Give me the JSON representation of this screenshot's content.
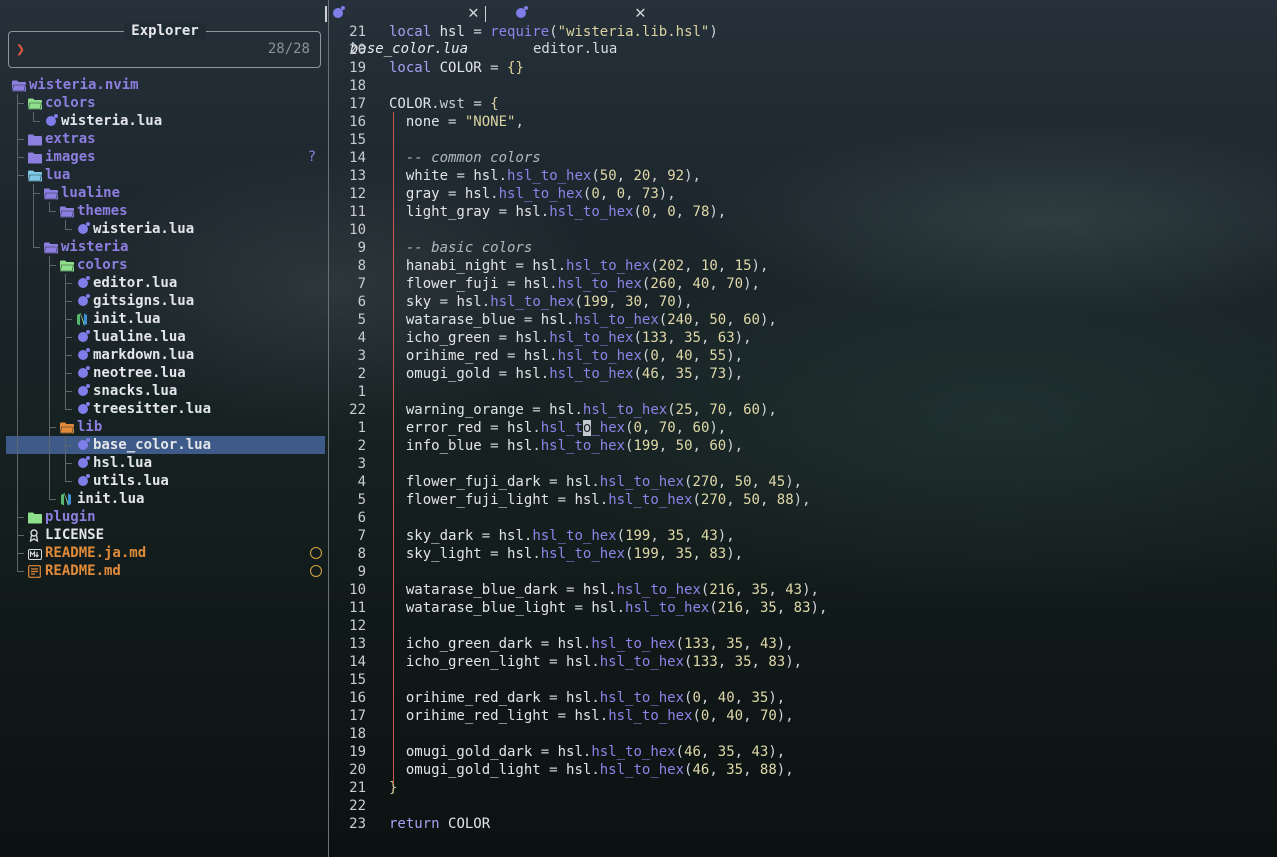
{
  "explorer": {
    "title": "Explorer",
    "prompt_icon": "chevron-right-icon",
    "count": "28/28",
    "tree": [
      {
        "label": "wisteria.nvim",
        "kind": "root",
        "depth": 0,
        "icon": "folder-open-icon"
      },
      {
        "label": "colors",
        "kind": "dir",
        "depth": 1,
        "icon": "folder-open-icon",
        "icon_color": "#8fe08a"
      },
      {
        "label": "wisteria.lua",
        "kind": "file",
        "depth": 2,
        "icon": "lua-icon"
      },
      {
        "label": "extras",
        "kind": "dir",
        "depth": 1,
        "icon": "folder-icon"
      },
      {
        "label": "images",
        "kind": "dir",
        "depth": 1,
        "icon": "folder-icon",
        "badge": "?"
      },
      {
        "label": "lua",
        "kind": "dir",
        "depth": 1,
        "icon": "folder-open-icon",
        "icon_color": "#7fc8e6"
      },
      {
        "label": "lualine",
        "kind": "dir",
        "depth": 2,
        "icon": "folder-open-icon"
      },
      {
        "label": "themes",
        "kind": "dir",
        "depth": 3,
        "icon": "folder-open-icon"
      },
      {
        "label": "wisteria.lua",
        "kind": "file",
        "depth": 4,
        "icon": "lua-icon"
      },
      {
        "label": "wisteria",
        "kind": "dir",
        "depth": 2,
        "icon": "folder-open-icon"
      },
      {
        "label": "colors",
        "kind": "dir",
        "depth": 3,
        "icon": "folder-open-icon",
        "icon_color": "#8fe08a"
      },
      {
        "label": "editor.lua",
        "kind": "file",
        "depth": 4,
        "icon": "lua-icon"
      },
      {
        "label": "gitsigns.lua",
        "kind": "file",
        "depth": 4,
        "icon": "lua-icon"
      },
      {
        "label": "init.lua",
        "kind": "file",
        "depth": 4,
        "icon": "neovim-icon"
      },
      {
        "label": "lualine.lua",
        "kind": "file",
        "depth": 4,
        "icon": "lua-icon"
      },
      {
        "label": "markdown.lua",
        "kind": "file",
        "depth": 4,
        "icon": "lua-icon"
      },
      {
        "label": "neotree.lua",
        "kind": "file",
        "depth": 4,
        "icon": "lua-icon"
      },
      {
        "label": "snacks.lua",
        "kind": "file",
        "depth": 4,
        "icon": "lua-icon"
      },
      {
        "label": "treesitter.lua",
        "kind": "file",
        "depth": 4,
        "icon": "lua-icon"
      },
      {
        "label": "lib",
        "kind": "dir",
        "depth": 3,
        "icon": "folder-open-icon",
        "icon_color": "#e08a3a"
      },
      {
        "label": "base_color.lua",
        "kind": "file",
        "depth": 4,
        "icon": "lua-icon",
        "selected": true
      },
      {
        "label": "hsl.lua",
        "kind": "file",
        "depth": 4,
        "icon": "lua-icon"
      },
      {
        "label": "utils.lua",
        "kind": "file",
        "depth": 4,
        "icon": "lua-icon"
      },
      {
        "label": "init.lua",
        "kind": "file",
        "depth": 3,
        "icon": "neovim-icon"
      },
      {
        "label": "plugin",
        "kind": "dir",
        "depth": 1,
        "icon": "folder-icon",
        "icon_color": "#8fe08a"
      },
      {
        "label": "LICENSE",
        "kind": "file",
        "depth": 1,
        "icon": "license-icon"
      },
      {
        "label": "README.ja.md",
        "kind": "md",
        "depth": 1,
        "icon": "markdown-icon",
        "badge": "circle"
      },
      {
        "label": "README.md",
        "kind": "md",
        "depth": 1,
        "icon": "readme-icon",
        "badge": "circle"
      }
    ]
  },
  "tabs": [
    {
      "label": "base_color.lua",
      "active": true,
      "icon": "lua-icon",
      "close_icon": "close-icon"
    },
    {
      "label": "editor.lua",
      "active": false,
      "icon": "lua-icon",
      "close_icon": "close-icon"
    }
  ],
  "editor": {
    "cursor_line_index": 22,
    "cursor_col": 12,
    "lines": [
      {
        "n": "21",
        "code": "local hsl = require(\"wisteria.lib.hsl\")"
      },
      {
        "n": "20",
        "code": ""
      },
      {
        "n": "19",
        "code": "local COLOR = {}"
      },
      {
        "n": "18",
        "code": ""
      },
      {
        "n": "17",
        "code": "COLOR.wst = {"
      },
      {
        "n": "16",
        "code": "  none = \"NONE\","
      },
      {
        "n": "15",
        "code": ""
      },
      {
        "n": "14",
        "code": "  -- common colors"
      },
      {
        "n": "13",
        "code": "  white = hsl.hsl_to_hex(50, 20, 92),"
      },
      {
        "n": "12",
        "code": "  gray = hsl.hsl_to_hex(0, 0, 73),"
      },
      {
        "n": "11",
        "code": "  light_gray = hsl.hsl_to_hex(0, 0, 78),"
      },
      {
        "n": "10",
        "code": ""
      },
      {
        "n": "9",
        "code": "  -- basic colors"
      },
      {
        "n": "8",
        "code": "  hanabi_night = hsl.hsl_to_hex(202, 10, 15),"
      },
      {
        "n": "7",
        "code": "  flower_fuji = hsl.hsl_to_hex(260, 40, 70),"
      },
      {
        "n": "6",
        "code": "  sky = hsl.hsl_to_hex(199, 30, 70),"
      },
      {
        "n": "5",
        "code": "  watarase_blue = hsl.hsl_to_hex(240, 50, 60),"
      },
      {
        "n": "4",
        "code": "  icho_green = hsl.hsl_to_hex(133, 35, 63),"
      },
      {
        "n": "3",
        "code": "  orihime_red = hsl.hsl_to_hex(0, 40, 55),"
      },
      {
        "n": "2",
        "code": "  omugi_gold = hsl.hsl_to_hex(46, 35, 73),"
      },
      {
        "n": "1",
        "code": ""
      },
      {
        "n": "22",
        "code": "  warning_orange = hsl.hsl_to_hex(25, 70, 60),"
      },
      {
        "n": "1",
        "code": "  error_red = hsl.hsl_to_hex(0, 70, 60),"
      },
      {
        "n": "2",
        "code": "  info_blue = hsl.hsl_to_hex(199, 50, 60),"
      },
      {
        "n": "3",
        "code": ""
      },
      {
        "n": "4",
        "code": "  flower_fuji_dark = hsl.hsl_to_hex(270, 50, 45),"
      },
      {
        "n": "5",
        "code": "  flower_fuji_light = hsl.hsl_to_hex(270, 50, 88),"
      },
      {
        "n": "6",
        "code": ""
      },
      {
        "n": "7",
        "code": "  sky_dark = hsl.hsl_to_hex(199, 35, 43),"
      },
      {
        "n": "8",
        "code": "  sky_light = hsl.hsl_to_hex(199, 35, 83),"
      },
      {
        "n": "9",
        "code": ""
      },
      {
        "n": "10",
        "code": "  watarase_blue_dark = hsl.hsl_to_hex(216, 35, 43),"
      },
      {
        "n": "11",
        "code": "  watarase_blue_light = hsl.hsl_to_hex(216, 35, 83),"
      },
      {
        "n": "12",
        "code": ""
      },
      {
        "n": "13",
        "code": "  icho_green_dark = hsl.hsl_to_hex(133, 35, 43),"
      },
      {
        "n": "14",
        "code": "  icho_green_light = hsl.hsl_to_hex(133, 35, 83),"
      },
      {
        "n": "15",
        "code": ""
      },
      {
        "n": "16",
        "code": "  orihime_red_dark = hsl.hsl_to_hex(0, 40, 35),"
      },
      {
        "n": "17",
        "code": "  orihime_red_light = hsl.hsl_to_hex(0, 40, 70),"
      },
      {
        "n": "18",
        "code": ""
      },
      {
        "n": "19",
        "code": "  omugi_gold_dark = hsl.hsl_to_hex(46, 35, 43),"
      },
      {
        "n": "20",
        "code": "  omugi_gold_light = hsl.hsl_to_hex(46, 35, 88),"
      },
      {
        "n": "21",
        "code": "}"
      },
      {
        "n": "22",
        "code": ""
      },
      {
        "n": "23",
        "code": "return COLOR"
      }
    ]
  },
  "colors": {
    "selection": "#3d5a88",
    "dir": "#8c7fe0",
    "markdown": "#e08a3a",
    "function": "#8c84e8",
    "number": "#e0d8a8",
    "indent_guide": "#c8584a"
  }
}
